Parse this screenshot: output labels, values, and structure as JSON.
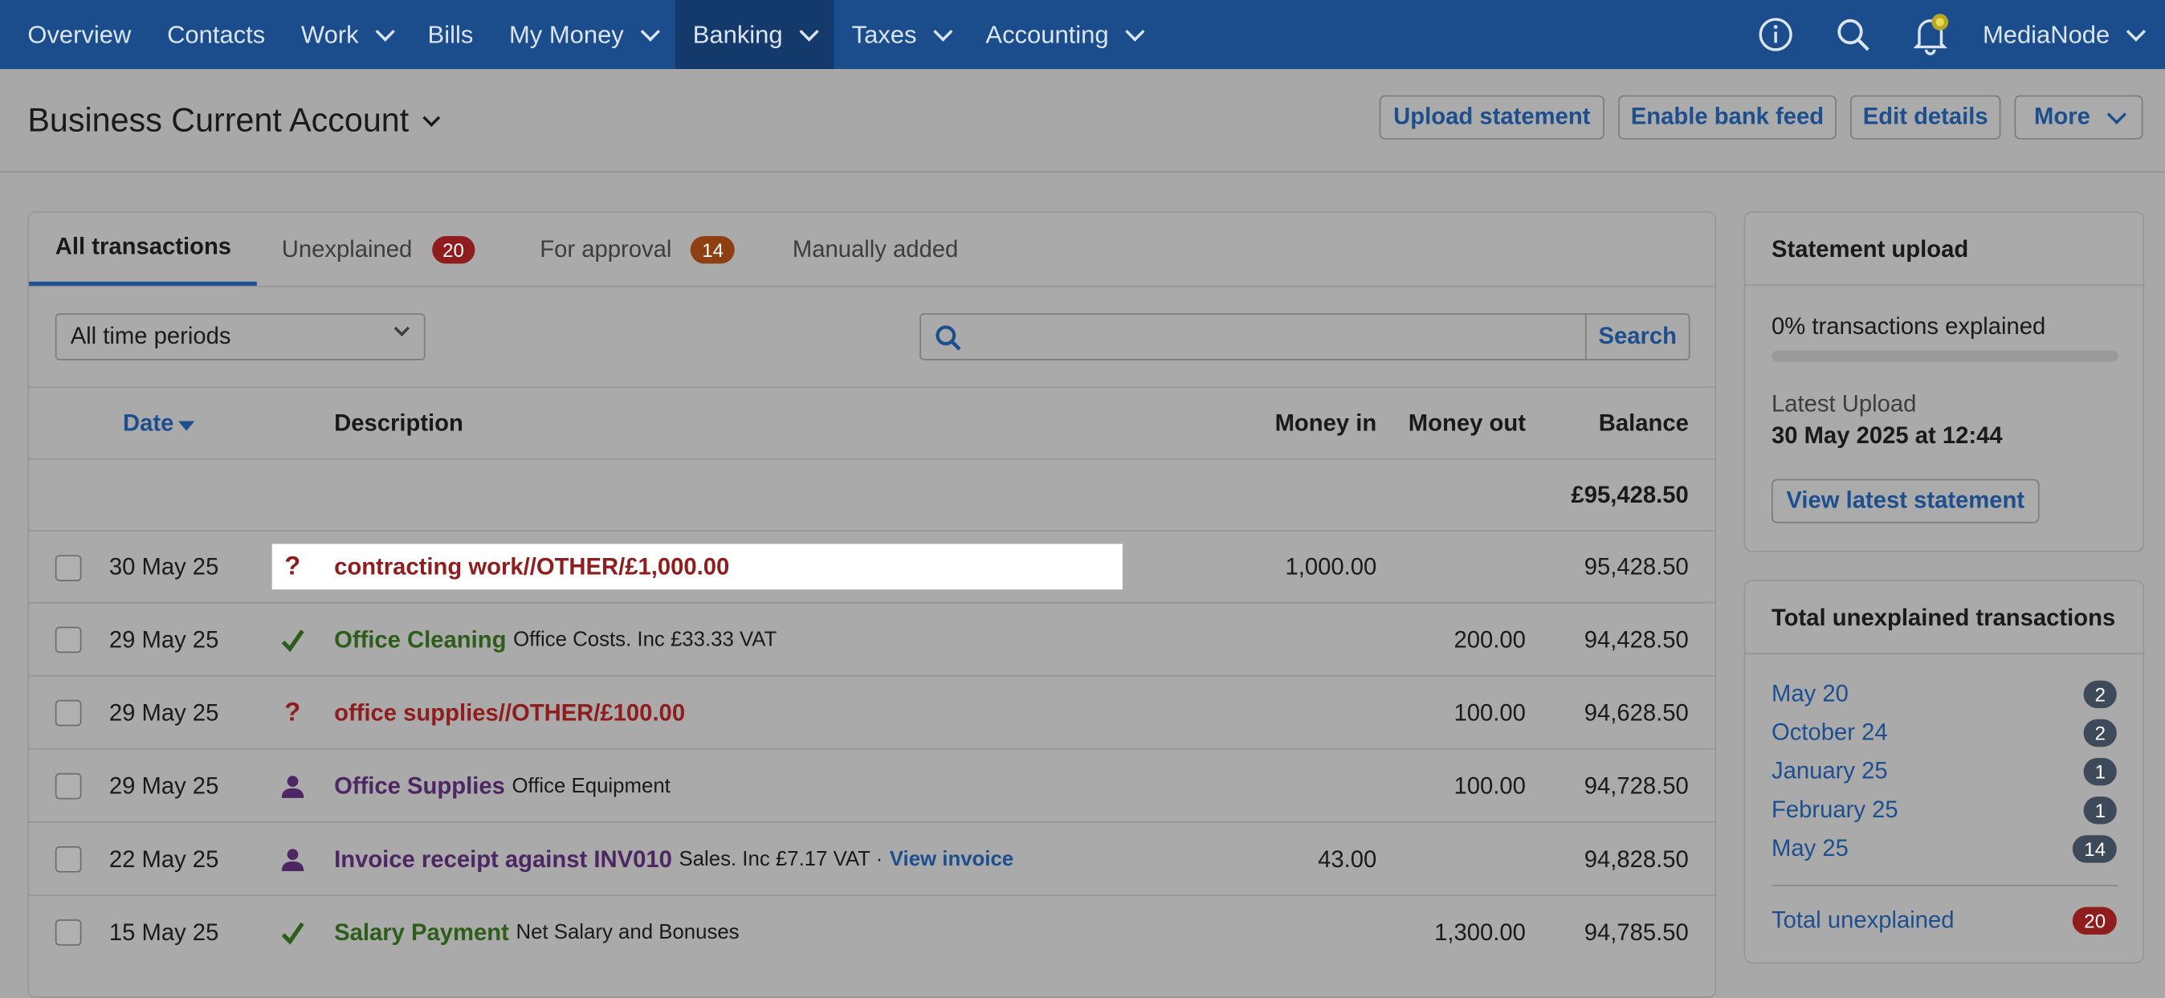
{
  "nav": {
    "items": [
      {
        "label": "Overview",
        "dropdown": false
      },
      {
        "label": "Contacts",
        "dropdown": false
      },
      {
        "label": "Work",
        "dropdown": true
      },
      {
        "label": "Bills",
        "dropdown": false
      },
      {
        "label": "My Money",
        "dropdown": true
      },
      {
        "label": "Banking",
        "dropdown": true,
        "active": true
      },
      {
        "label": "Taxes",
        "dropdown": true
      },
      {
        "label": "Accounting",
        "dropdown": true
      }
    ],
    "org_name": "MediaNode",
    "icons": [
      "info-icon",
      "search-icon",
      "bell-icon"
    ]
  },
  "header": {
    "title": "Business Current Account",
    "buttons": {
      "upload": "Upload statement",
      "bank_feed": "Enable bank feed",
      "edit": "Edit details",
      "more": "More"
    }
  },
  "tabs": [
    {
      "label": "All transactions",
      "active": true,
      "badge": null
    },
    {
      "label": "Unexplained",
      "badge": "20",
      "badge_color": "#8f1d1d"
    },
    {
      "label": "For approval",
      "badge": "14",
      "badge_color": "#8f4012"
    },
    {
      "label": "Manually added",
      "badge": null
    }
  ],
  "filters": {
    "period": "All time periods",
    "search_value": "",
    "search_button": "Search"
  },
  "table": {
    "columns": {
      "date": "Date",
      "description": "Description",
      "money_in": "Money in",
      "money_out": "Money out",
      "balance": "Balance"
    },
    "opening_balance": "£95,428.50",
    "rows": [
      {
        "date": "30 May 25",
        "status": "unexplained",
        "title": "contracting work//OTHER/£1,000.00",
        "sub": "",
        "link": "",
        "money_in": "1,000.00",
        "money_out": "",
        "balance": "95,428.50"
      },
      {
        "date": "29 May 25",
        "status": "explained",
        "title": "Office Cleaning",
        "sub": "Office Costs. Inc £33.33 VAT",
        "link": "",
        "money_in": "",
        "money_out": "200.00",
        "balance": "94,428.50"
      },
      {
        "date": "29 May 25",
        "status": "unexplained",
        "title": "office supplies//OTHER/£100.00",
        "sub": "",
        "link": "",
        "money_in": "",
        "money_out": "100.00",
        "balance": "94,628.50"
      },
      {
        "date": "29 May 25",
        "status": "approval",
        "title": "Office Supplies",
        "sub": "Office Equipment",
        "link": "",
        "money_in": "",
        "money_out": "100.00",
        "balance": "94,728.50"
      },
      {
        "date": "22 May 25",
        "status": "approval",
        "title": "Invoice receipt against INV010",
        "sub": "Sales. Inc £7.17 VAT ·",
        "link": "View invoice",
        "money_in": "43.00",
        "money_out": "",
        "balance": "94,828.50"
      },
      {
        "date": "15 May 25",
        "status": "explained",
        "title": "Salary Payment",
        "sub": "Net Salary and Bonuses",
        "link": "",
        "money_in": "",
        "money_out": "1,300.00",
        "balance": "94,785.50"
      }
    ]
  },
  "statement_upload": {
    "title": "Statement upload",
    "explained_text": "0% transactions explained",
    "explained_fraction": 0,
    "latest_label": "Latest Upload",
    "latest_value": "30 May 2025 at 12:44",
    "view_button": "View latest statement"
  },
  "unexplained_panel": {
    "title": "Total unexplained transactions",
    "items": [
      {
        "label": "May 20",
        "count": "2"
      },
      {
        "label": "October 24",
        "count": "2"
      },
      {
        "label": "January 25",
        "count": "1"
      },
      {
        "label": "February 25",
        "count": "1"
      },
      {
        "label": "May 25",
        "count": "14"
      }
    ],
    "total_label": "Total unexplained",
    "total_count": "20"
  }
}
